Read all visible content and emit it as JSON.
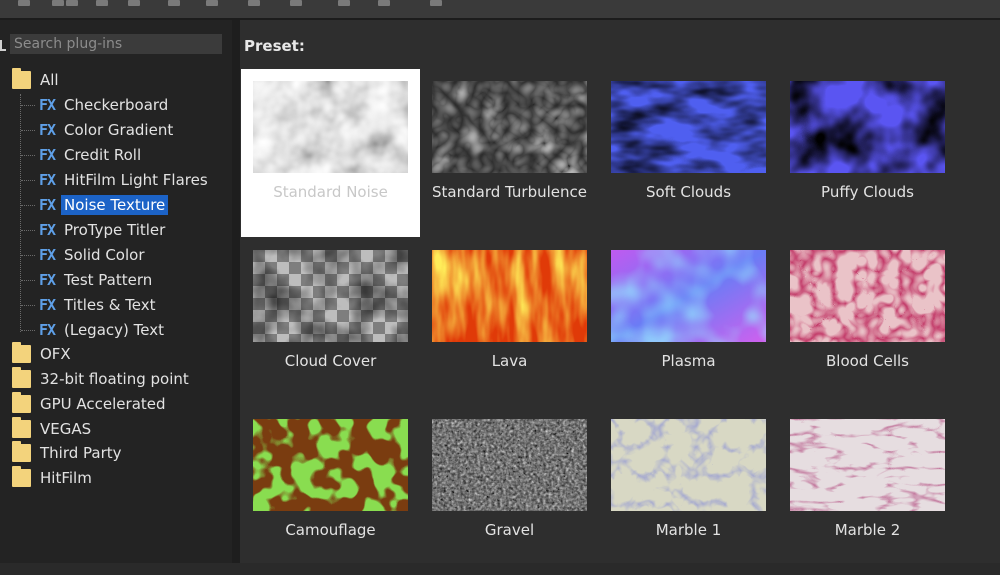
{
  "search": {
    "placeholder": "Search plug-ins"
  },
  "tree": {
    "root_label": "All",
    "plugins": [
      "Checkerboard",
      "Color Gradient",
      "Credit Roll",
      "HitFilm Light Flares",
      "Noise Texture",
      "ProType Titler",
      "Solid Color",
      "Test Pattern",
      "Titles & Text",
      "(Legacy) Text"
    ],
    "selected_plugin": "Noise Texture",
    "fx_badge": "FX",
    "folders": [
      "OFX",
      "32-bit floating point",
      "GPU Accelerated",
      "VEGAS",
      "Third Party",
      "HitFilm"
    ]
  },
  "preset": {
    "label": "Preset:",
    "selected": "Standard Noise",
    "items": [
      "Standard Noise",
      "Standard Turbulence",
      "Soft Clouds",
      "Puffy Clouds",
      "Cloud Cover",
      "Lava",
      "Plasma",
      "Blood Cells",
      "Camouflage",
      "Gravel",
      "Marble 1",
      "Marble 2"
    ]
  },
  "colors": {
    "selection_blue": "#1c63c7",
    "folder_yellow": "#f3d37c",
    "fx_blue": "#5fa0e8"
  },
  "icons": {
    "plugin": "fx-icon",
    "folder": "folder-icon"
  }
}
